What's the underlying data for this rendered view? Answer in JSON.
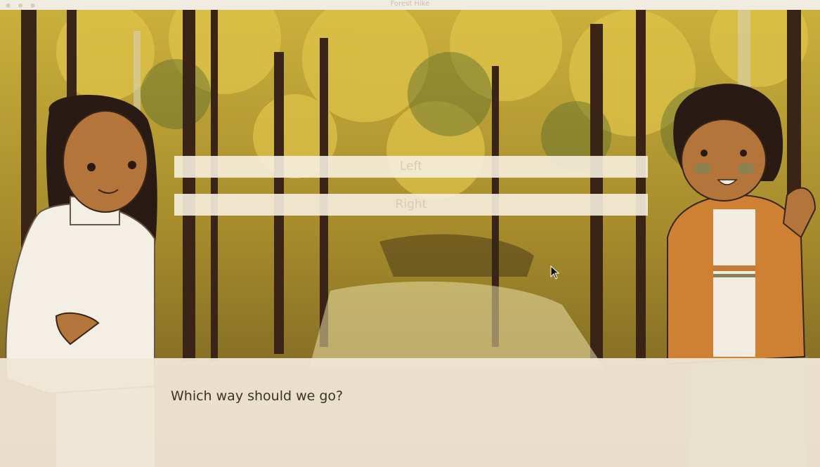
{
  "window": {
    "title": "Forest Hike"
  },
  "menu": {
    "choices": [
      {
        "label": "Left"
      },
      {
        "label": "Right"
      }
    ]
  },
  "dialogue": {
    "text": "Which way should we go?"
  }
}
